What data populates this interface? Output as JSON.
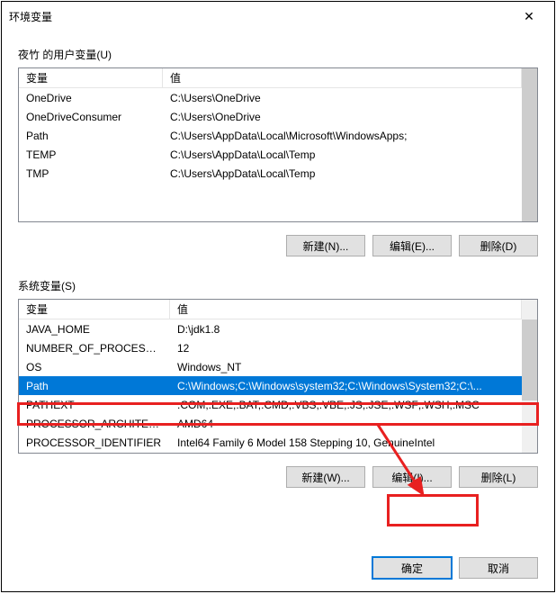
{
  "window": {
    "title": "环境变量"
  },
  "user_section": {
    "label": "夜竹 的用户变量(U)",
    "headers": {
      "name": "变量",
      "value": "值"
    },
    "rows": [
      {
        "name": "OneDrive",
        "value": "C:\\Users\\OneDrive"
      },
      {
        "name": "OneDriveConsumer",
        "value": "C:\\Users\\OneDrive"
      },
      {
        "name": "Path",
        "value": "C:\\Users\\AppData\\Local\\Microsoft\\WindowsApps;"
      },
      {
        "name": "TEMP",
        "value": "C:\\Users\\AppData\\Local\\Temp"
      },
      {
        "name": "TMP",
        "value": "C:\\Users\\AppData\\Local\\Temp"
      }
    ],
    "buttons": {
      "new": "新建(N)...",
      "edit": "编辑(E)...",
      "delete": "删除(D)"
    }
  },
  "system_section": {
    "label": "系统变量(S)",
    "headers": {
      "name": "变量",
      "value": "值"
    },
    "rows": [
      {
        "name": "JAVA_HOME",
        "value": "D:\\jdk1.8"
      },
      {
        "name": "NUMBER_OF_PROCESSORS",
        "value": "12"
      },
      {
        "name": "OS",
        "value": "Windows_NT"
      },
      {
        "name": "Path",
        "value": "C:\\Windows;C:\\Windows\\system32;C:\\Windows\\System32;C:\\..."
      },
      {
        "name": "PATHEXT",
        "value": ".COM;.EXE;.BAT;.CMD;.VBS;.VBE;.JS;.JSE;.WSF;.WSH;.MSC"
      },
      {
        "name": "PROCESSOR_ARCHITECT...",
        "value": "AMD64"
      },
      {
        "name": "PROCESSOR_IDENTIFIER",
        "value": "Intel64 Family 6 Model 158 Stepping 10, GenuineIntel"
      }
    ],
    "selected_index": 3,
    "buttons": {
      "new": "新建(W)...",
      "edit": "编辑(I)...",
      "delete": "删除(L)"
    }
  },
  "footer": {
    "ok": "确定",
    "cancel": "取消"
  }
}
